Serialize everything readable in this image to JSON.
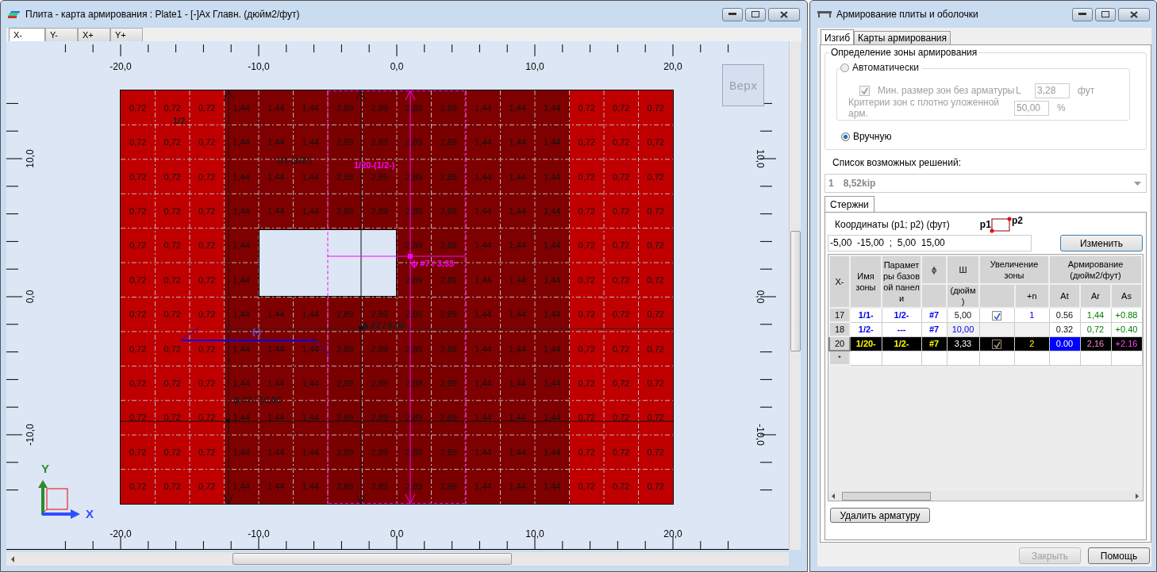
{
  "main_window": {
    "title": "Плита - карта армирования : Plate1 - [-]Ax Главн. (дюйм2/фут)",
    "tabs": [
      {
        "label": "X-",
        "selected": true
      },
      {
        "label": "Y-",
        "selected": false
      },
      {
        "label": "X+",
        "selected": false
      },
      {
        "label": "Y+",
        "selected": false
      }
    ],
    "view_button": "Верх",
    "top_ruler": [
      "-20,0",
      "-10,0",
      "0,0",
      "10,0",
      "20,0"
    ],
    "bottom_ruler": [
      "-20,0",
      "-10,0",
      "0,0",
      "10,0",
      "20,0"
    ],
    "left_ruler": [
      "10,0",
      "0,0",
      "-10,0"
    ],
    "right_ruler": [
      "10,0",
      "0,0",
      "-10,0"
    ],
    "plate": {
      "columns": [
        {
          "color": "#c00000"
        },
        {
          "color": "#c00000"
        },
        {
          "color": "#c00000"
        },
        {
          "color": "#7f0000"
        },
        {
          "color": "#7f0000"
        },
        {
          "color": "#7f0000"
        },
        {
          "color": "#7a0000"
        },
        {
          "color": "#7a0000"
        },
        {
          "color": "#7a0000"
        },
        {
          "color": "#7a0000"
        },
        {
          "color": "#7f0000"
        },
        {
          "color": "#7f0000"
        },
        {
          "color": "#7f0000"
        },
        {
          "color": "#c00000"
        },
        {
          "color": "#c00000"
        },
        {
          "color": "#c00000"
        }
      ],
      "rows": [
        [
          "0,72",
          "0,72",
          "0,72",
          "1,44",
          "1,44",
          "1,44",
          "2,89",
          "2,89",
          "2,89",
          "2,89",
          "1,44",
          "1,44",
          "1,44",
          "0,72",
          "0,72",
          "0,72"
        ],
        [
          "0,72",
          "0,72",
          "0,72",
          "1,44",
          "1,44",
          "1,44",
          "2,89",
          "2,89",
          "2,89",
          "2,89",
          "1,44",
          "1,44",
          "1,44",
          "0,72",
          "0,72",
          "0,72"
        ],
        [
          "0,72",
          "0,72",
          "0,72",
          "1,44",
          "1,44",
          "1,44",
          "2,89",
          "2,89",
          "2,89",
          "2,89",
          "1,44",
          "1,44",
          "1,44",
          "0,72",
          "0,72",
          "0,72"
        ],
        [
          "0,72",
          "0,72",
          "0,72",
          "1,44",
          "1,44",
          "1,44",
          "2,89",
          "2,89",
          "2,89",
          "2,89",
          "1,44",
          "1,44",
          "1,44",
          "0,72",
          "0,72",
          "0,72"
        ],
        [
          "0,72",
          "0,72",
          "0,72",
          "1,44",
          null,
          null,
          null,
          null,
          "2,89",
          "2,89",
          "1,44",
          "1,44",
          "1,44",
          "0,72",
          "0,72",
          "0,72"
        ],
        [
          "0,72",
          "0,72",
          "0,72",
          "1,44",
          null,
          null,
          null,
          null,
          "2,89",
          "2,89",
          "1,44",
          "1,44",
          "1,44",
          "0,72",
          "0,72",
          "0,72"
        ],
        [
          "0,72",
          "0,72",
          "0,72",
          "1,44",
          "1,44",
          "1,44",
          "2,89",
          "2,89",
          "2,89",
          "2,89",
          "1,44",
          "1,44",
          "1,44",
          "0,72",
          "0,72",
          "0,72"
        ],
        [
          "0,72",
          "0,72",
          "0,72",
          "1,44",
          "1,44",
          "1,44",
          "2,89",
          "2,89",
          "2,89",
          "2,89",
          "1,44",
          "1,44",
          "1,44",
          "0,72",
          "0,72",
          "0,72"
        ],
        [
          "0,72",
          "0,72",
          "0,72",
          "1,44",
          "1,44",
          "1,44",
          "2,89",
          "2,89",
          "2,89",
          "2,89",
          "1,44",
          "1,44",
          "1,44",
          "0,72",
          "0,72",
          "0,72"
        ],
        [
          "0,72",
          "0,72",
          "0,72",
          "1,44",
          "1,44",
          "1,44",
          "2,89",
          "2,89",
          "2,89",
          "2,89",
          "1,44",
          "1,44",
          "1,44",
          "0,72",
          "0,72",
          "0,72"
        ],
        [
          "0,72",
          "0,72",
          "0,72",
          "1,44",
          "1,44",
          "1,44",
          "2,89",
          "2,89",
          "2,89",
          "2,89",
          "1,44",
          "1,44",
          "1,44",
          "0,72",
          "0,72",
          "0,72"
        ],
        [
          "0,72",
          "0,72",
          "0,72",
          "1,44",
          "1,44",
          "1,44",
          "2,89",
          "2,89",
          "2,89",
          "2,89",
          "1,44",
          "1,44",
          "1,44",
          "0,72",
          "0,72",
          "0,72"
        ]
      ]
    },
    "annotations": [
      {
        "text": "1/2-",
        "color": "#1a1a1a"
      },
      {
        "text": "1/1-(1/2-)",
        "color": "#1a1a1a"
      },
      {
        "text": "1/20-(1/2-)",
        "color": "#ff00ff"
      },
      {
        "text": "ϕ #7 / 3,33",
        "color": "#ff00ff"
      },
      {
        "text": "ϕ #7 / 5,00",
        "color": "#1a1a1a"
      },
      {
        "text": "(-)",
        "color": "#5a5aff"
      },
      {
        "text": "ϕ #7 / 10,00",
        "color": "#1a1a1a"
      }
    ],
    "axes": {
      "x": "X",
      "y": "Y"
    }
  },
  "dialog": {
    "title": "Армирование плиты и оболочки",
    "tabs": [
      {
        "label": "Изгиб",
        "selected": true
      },
      {
        "label": "Карты армирования",
        "selected": false
      }
    ],
    "zone_group": {
      "title": "Определение зоны армирования",
      "auto": {
        "label": "Автоматически",
        "selected": false
      },
      "min_size": {
        "label": "Мин. размер зон без арматуры",
        "checked": true,
        "disabled": true,
        "symbol": "L",
        "value": "3,28",
        "unit": "фут"
      },
      "dense": {
        "label": "Критерии зон с плотно уложенной арм.",
        "value": "50,00",
        "unit": "%"
      },
      "manual": {
        "label": "Вручную",
        "selected": true
      }
    },
    "solutions_label": "Список возможных решений:",
    "solution": {
      "index": "1",
      "value": "8,52kip"
    },
    "bars_tab": {
      "label": "Стержни",
      "selected": true
    },
    "coords_label": "Координаты (p1; p2) (фут)",
    "p1": "p1",
    "p2": "p2",
    "coords_value": "-5,00  -15,00  ;  5,00  15,00",
    "change_button": "Изменить",
    "table": {
      "corner": "X-",
      "zone": "Имя зоны",
      "base": "Параметры базовой панели",
      "phi": "ϕ",
      "spacing": "Ш",
      "spacing_unit": "(дюйм )",
      "increase": "Увеличение зоны",
      "plus_n": "+n",
      "reinforcement": "Армирование (дюйм2/фут)",
      "at": "At",
      "ar": "Ar",
      "as": "As",
      "rows": [
        {
          "id": "17",
          "zone": "1/1-",
          "base": "1/2-",
          "phi": "#7",
          "spacing": "5,00",
          "checked": true,
          "n": "1",
          "at": "0.56",
          "ar": "1,44",
          "as": "+0.88",
          "selected": false
        },
        {
          "id": "18",
          "zone": "1/2-",
          "base": "---",
          "phi": "#7",
          "spacing": "10,00",
          "checked": false,
          "at": "0.32",
          "ar": "0,72",
          "as": "+0.40",
          "selected": false
        },
        {
          "id": "20",
          "zone": "1/20-",
          "base": "1/2-",
          "phi": "#7",
          "spacing": "3,33",
          "checked": true,
          "n": "2",
          "at": "0.00",
          "ar": "2,16",
          "as": "+2.16",
          "selected": true
        }
      ],
      "new_row": "*"
    },
    "delete_button": "Удалить арматуру",
    "buttons": [
      {
        "label": "Закрыть",
        "disabled": true
      },
      {
        "label": "Помощь",
        "disabled": false
      }
    ]
  }
}
